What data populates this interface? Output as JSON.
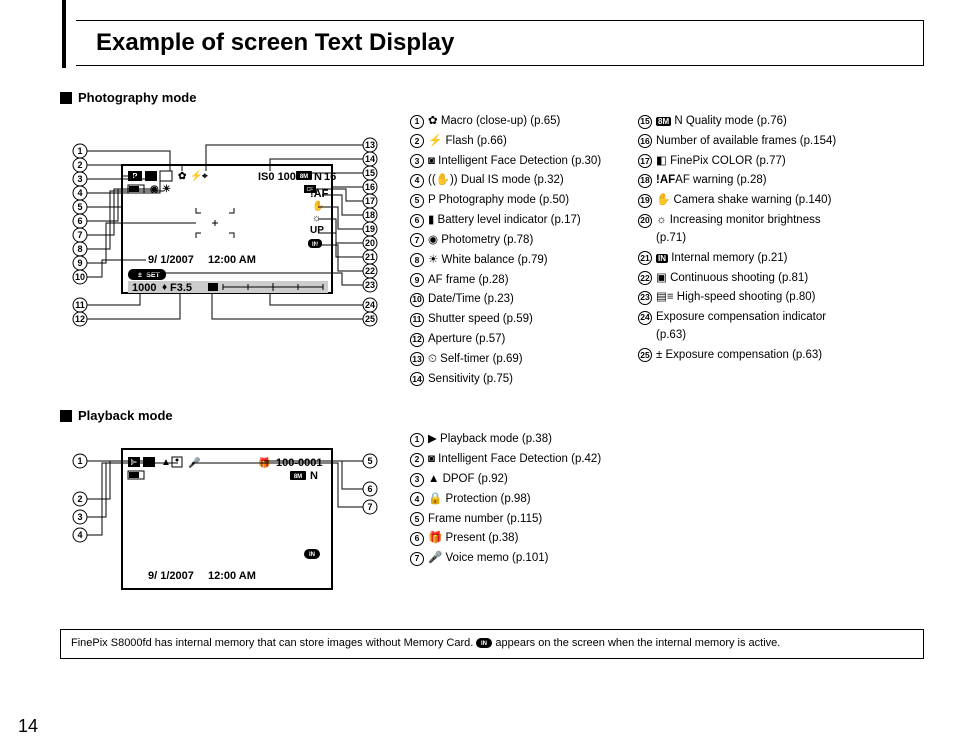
{
  "page_number": "14",
  "title": "Example of screen Text Display",
  "photo": {
    "heading": "Photography mode",
    "screen": {
      "date": "9/ 1/2007",
      "time": "12:00 AM",
      "set_label": "SET",
      "shutter": "1000",
      "aperture": "F3.5",
      "iso": "IS0 100",
      "quality": "8M",
      "n": "N",
      "frames": "16",
      "af_warn": "!AF",
      "up": "UP",
      "in": "IN"
    },
    "legend_left": [
      {
        "n": "1",
        "t": "Macro (close-up) (p.65)",
        "icon": "macro"
      },
      {
        "n": "2",
        "t": "Flash (p.66)",
        "icon": "flash"
      },
      {
        "n": "3",
        "t": "Intelligent Face Detection (p.30)",
        "icon": "face"
      },
      {
        "n": "4",
        "t": "Dual IS mode (p.32)",
        "icon": "is"
      },
      {
        "n": "5",
        "t": "Photography mode (p.50)",
        "icon": "p"
      },
      {
        "n": "6",
        "t": "Battery level indicator (p.17)",
        "icon": "batt"
      },
      {
        "n": "7",
        "t": "Photometry (p.78)",
        "icon": "meter"
      },
      {
        "n": "8",
        "t": "White balance (p.79)",
        "icon": "wb"
      },
      {
        "n": "9",
        "t": "AF frame (p.28)",
        "icon": ""
      },
      {
        "n": "10",
        "t": "Date/Time (p.23)",
        "icon": ""
      },
      {
        "n": "11",
        "t": "Shutter speed (p.59)",
        "icon": ""
      },
      {
        "n": "12",
        "t": "Aperture (p.57)",
        "icon": ""
      },
      {
        "n": "13",
        "t": "Self-timer (p.69)",
        "icon": "timer"
      },
      {
        "n": "14",
        "t": "Sensitivity (p.75)",
        "icon": ""
      }
    ],
    "legend_right": [
      {
        "n": "15",
        "t": "N Quality mode (p.76)",
        "icon": "8m"
      },
      {
        "n": "16",
        "t": "Number of available frames (p.154)",
        "icon": ""
      },
      {
        "n": "17",
        "t": "FinePix COLOR (p.77)",
        "icon": "color"
      },
      {
        "n": "18",
        "t": "AF warning (p.28)",
        "icon": "af",
        "prefix": "!AF"
      },
      {
        "n": "19",
        "t": "Camera shake warning (p.140)",
        "icon": "shake"
      },
      {
        "n": "20",
        "t": "Increasing monitor brightness (p.71)",
        "icon": "bright"
      },
      {
        "n": "21",
        "t": "Internal memory (p.21)",
        "icon": "in"
      },
      {
        "n": "22",
        "t": "Continuous shooting (p.81)",
        "icon": "cont"
      },
      {
        "n": "23",
        "t": "High-speed shooting (p.80)",
        "icon": "speed"
      },
      {
        "n": "24",
        "t": "Exposure compensation indicator (p.63)",
        "icon": ""
      },
      {
        "n": "25",
        "t": "Exposure compensation (p.63)",
        "icon": "ev"
      }
    ]
  },
  "playback": {
    "heading": "Playback mode",
    "screen": {
      "frame": "100-0001",
      "quality": "8M",
      "n": "N",
      "date": "9/ 1/2007",
      "time": "12:00 AM",
      "in": "IN"
    },
    "legend": [
      {
        "n": "1",
        "t": "Playback mode (p.38)",
        "icon": "play"
      },
      {
        "n": "2",
        "t": "Intelligent Face Detection (p.42)",
        "icon": "face"
      },
      {
        "n": "3",
        "t": "DPOF (p.92)",
        "icon": "dpof"
      },
      {
        "n": "4",
        "t": "Protection (p.98)",
        "icon": "lock"
      },
      {
        "n": "5",
        "t": "Frame number (p.115)",
        "icon": ""
      },
      {
        "n": "6",
        "t": "Present (p.38)",
        "icon": "gift"
      },
      {
        "n": "7",
        "t": "Voice memo (p.101)",
        "icon": "mic"
      }
    ]
  },
  "note": {
    "text1": "FinePix S8000fd has internal memory that can store images without Memory Card. ",
    "text2": " appears on the screen when the internal memory is active."
  }
}
